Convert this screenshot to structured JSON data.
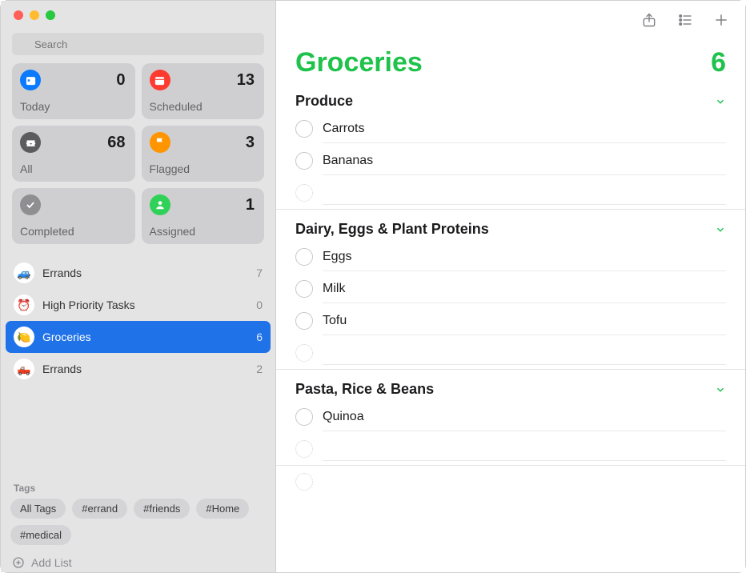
{
  "search": {
    "placeholder": "Search"
  },
  "smartLists": [
    {
      "id": "today",
      "label": "Today",
      "count": "0",
      "icon": "calendar-today",
      "color": "blue"
    },
    {
      "id": "scheduled",
      "label": "Scheduled",
      "count": "13",
      "icon": "calendar",
      "color": "red"
    },
    {
      "id": "all",
      "label": "All",
      "count": "68",
      "icon": "tray",
      "color": "dark"
    },
    {
      "id": "flagged",
      "label": "Flagged",
      "count": "3",
      "icon": "flag",
      "color": "orange"
    },
    {
      "id": "completed",
      "label": "Completed",
      "count": "",
      "icon": "check",
      "color": "gray"
    },
    {
      "id": "assigned",
      "label": "Assigned",
      "count": "1",
      "icon": "person",
      "color": "green"
    }
  ],
  "userLists": [
    {
      "label": "Errands",
      "count": "7",
      "emoji": "🚙",
      "selected": false
    },
    {
      "label": "High Priority Tasks",
      "count": "0",
      "emoji": "⏰",
      "selected": false
    },
    {
      "label": "Groceries",
      "count": "6",
      "emoji": "🍋",
      "selected": true
    },
    {
      "label": "Errands",
      "count": "2",
      "emoji": "🛻",
      "selected": false
    }
  ],
  "tagsHeader": "Tags",
  "tags": [
    "All Tags",
    "#errand",
    "#friends",
    "#Home",
    "#medical"
  ],
  "addList": "Add List",
  "main": {
    "title": "Groceries",
    "count": "6",
    "sections": [
      {
        "title": "Produce",
        "items": [
          "Carrots",
          "Bananas"
        ]
      },
      {
        "title": "Dairy, Eggs & Plant Proteins",
        "items": [
          "Eggs",
          "Milk",
          "Tofu"
        ]
      },
      {
        "title": "Pasta, Rice & Beans",
        "items": [
          "Quinoa"
        ]
      }
    ]
  }
}
